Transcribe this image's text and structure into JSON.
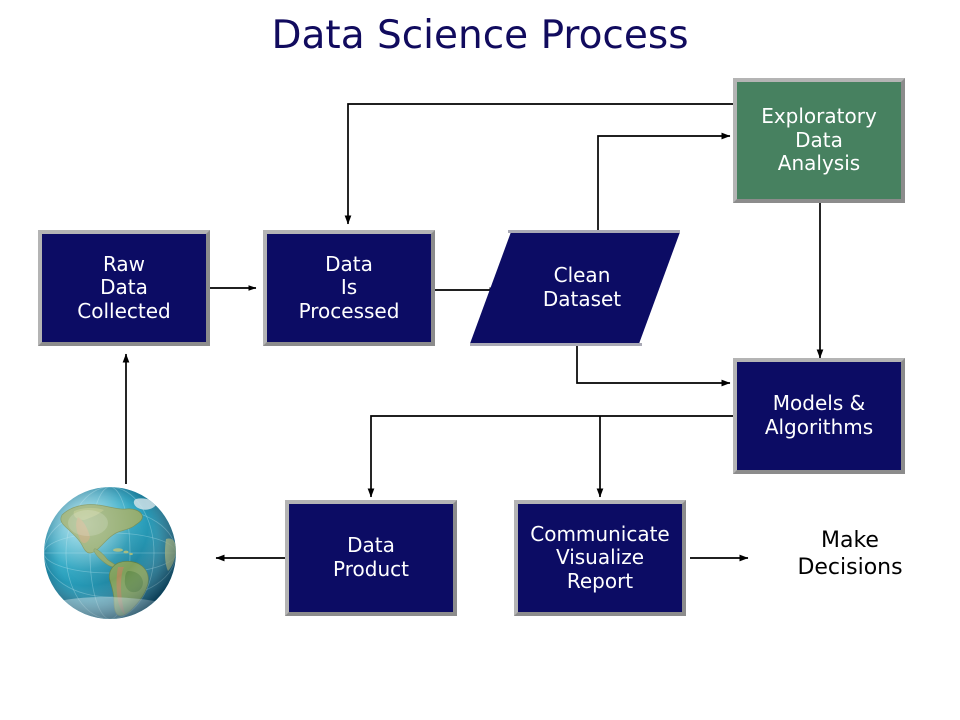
{
  "page": {
    "title": "Data Science Process",
    "background": "#ffffff",
    "title_color": "#110b5e"
  },
  "palette": {
    "navy": "#0c0c64",
    "green": "#478160",
    "border_gray": "#9a9a9a",
    "text_white": "#ffffff",
    "text_black": "#000000",
    "connector": "#000000"
  },
  "nodes": {
    "raw_data": {
      "label": "Raw\nData\nCollected",
      "shape": "rectangle",
      "fill": "#0c0c64"
    },
    "data_processed": {
      "label": "Data\nIs\nProcessed",
      "shape": "rectangle",
      "fill": "#0c0c64"
    },
    "clean_dataset": {
      "label": "Clean\nDataset",
      "shape": "parallelogram",
      "fill": "#0c0c64"
    },
    "eda": {
      "label": "Exploratory\nData\nAnalysis",
      "shape": "rectangle",
      "fill": "#478160"
    },
    "models": {
      "label": "Models &\nAlgorithms",
      "shape": "rectangle",
      "fill": "#0c0c64"
    },
    "data_product": {
      "label": "Data\nProduct",
      "shape": "rectangle",
      "fill": "#0c0c64"
    },
    "communicate": {
      "label": "Communicate\nVisualize\nReport",
      "shape": "rectangle",
      "fill": "#0c0c64"
    },
    "make_decisions": {
      "label": "Make\nDecisions",
      "shape": "text",
      "fill": "none"
    },
    "globe": {
      "label": "globe-image",
      "shape": "circle",
      "fill": "#2aa7c4"
    }
  },
  "connections": [
    {
      "name": "globe-to-raw-data",
      "from": "globe",
      "to": "raw_data",
      "style": "straight-up"
    },
    {
      "name": "raw-data-to-data-processed",
      "from": "raw_data",
      "to": "data_processed",
      "style": "straight-right"
    },
    {
      "name": "data-processed-to-clean-dataset",
      "from": "data_processed",
      "to": "clean_dataset",
      "style": "straight-right"
    },
    {
      "name": "eda-to-data-processed",
      "from": "eda",
      "to": "data_processed",
      "style": "elbow-up-left-down"
    },
    {
      "name": "clean-dataset-to-eda",
      "from": "clean_dataset",
      "to": "eda",
      "style": "elbow-up-right"
    },
    {
      "name": "eda-to-models",
      "from": "eda",
      "to": "models",
      "style": "straight-down"
    },
    {
      "name": "clean-dataset-to-models",
      "from": "clean_dataset",
      "to": "models",
      "style": "elbow-down-right"
    },
    {
      "name": "models-to-data-product",
      "from": "models",
      "to": "data_product",
      "style": "elbow-left-down"
    },
    {
      "name": "models-to-communicate",
      "from": "models",
      "to": "communicate",
      "style": "elbow-left-down"
    },
    {
      "name": "data-product-to-globe",
      "from": "data_product",
      "to": "globe",
      "style": "straight-left"
    },
    {
      "name": "communicate-to-make-decisions",
      "from": "communicate",
      "to": "make_decisions",
      "style": "straight-right"
    }
  ]
}
